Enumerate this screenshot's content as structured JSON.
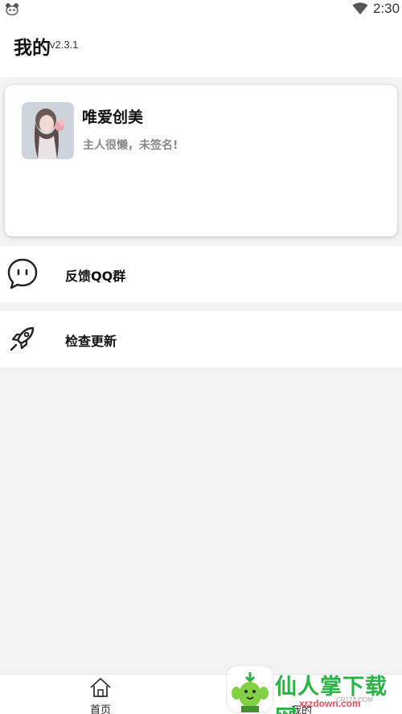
{
  "status_bar": {
    "time": "2:30",
    "left_icon": "panda-icon",
    "right_icon": "wifi-icon"
  },
  "header": {
    "title": "我的",
    "version": "v2.3.1"
  },
  "profile": {
    "name": "唯爱创美",
    "signature": "主人很懒，未签名!",
    "avatar": "avatar-photo"
  },
  "menu": {
    "items": [
      {
        "icon": "chat-bubble-icon",
        "label": "反馈QQ群"
      },
      {
        "icon": "rocket-icon",
        "label": "检查更新"
      }
    ]
  },
  "bottom_nav": {
    "home_icon": "home-icon",
    "home_label": "首页",
    "mine_label": "我的"
  },
  "watermark": {
    "text": "仙人掌下载网",
    "url": "xrzdown.com",
    "small": "CR173.COM"
  },
  "colors": {
    "background": "#f3f3f3",
    "card": "#ffffff",
    "signature_gray": "#888888",
    "watermark_green": "#1fae3a",
    "watermark_red": "#e8465a"
  }
}
